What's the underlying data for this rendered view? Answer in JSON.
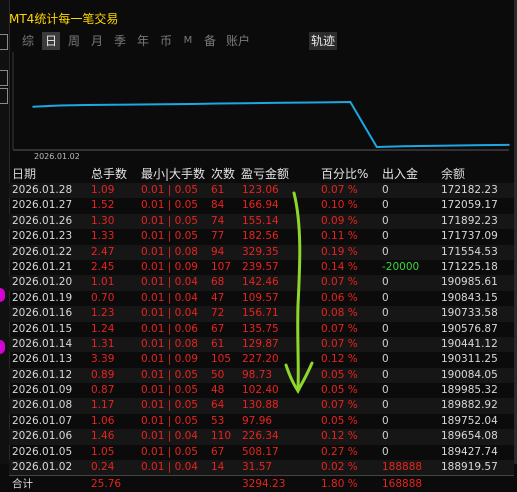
{
  "window": {
    "title": "MT4统计每一笔交易"
  },
  "tabs": [
    {
      "label": "综",
      "state": "inactive"
    },
    {
      "label": "日",
      "state": "active"
    },
    {
      "label": "周",
      "state": "inactive"
    },
    {
      "label": "月",
      "state": "inactive"
    },
    {
      "label": "季",
      "state": "inactive"
    },
    {
      "label": "年",
      "state": "inactive"
    },
    {
      "label": "币",
      "state": "inactive"
    },
    {
      "label": "M",
      "state": "inactive"
    },
    {
      "label": "备",
      "state": "inactive"
    },
    {
      "label": "账户",
      "state": "inactive"
    },
    {
      "label": "轨迹",
      "state": "selected"
    }
  ],
  "chart_data": {
    "type": "line",
    "x_start_label": "2026.01.02",
    "x": [
      "2026.01.02",
      "2026.01.05",
      "2026.01.06",
      "2026.01.07",
      "2026.01.08",
      "2026.01.09",
      "2026.01.12",
      "2026.01.13",
      "2026.01.14",
      "2026.01.15",
      "2026.01.16",
      "2026.01.19",
      "2026.01.20",
      "2026.01.21",
      "2026.01.22",
      "2026.01.23",
      "2026.01.26",
      "2026.01.27",
      "2026.01.28"
    ],
    "series": [
      {
        "values": [
          188919.57,
          189427.74,
          189654.08,
          189752.04,
          189882.92,
          189985.32,
          190084.05,
          190311.25,
          190441.12,
          190576.87,
          190733.58,
          190843.15,
          190985.61,
          171225.18,
          171554.53,
          171737.09,
          171892.23,
          172059.17,
          172182.23
        ]
      }
    ],
    "line_color": "#1ea7e1"
  },
  "table": {
    "headers": {
      "date": "日期",
      "lots": "总手数",
      "minmax": "最小|大手数",
      "count": "次数",
      "pnl": "盈亏金额",
      "pct": "百分比%",
      "io": "出入金",
      "balance": "余额"
    },
    "rows": [
      {
        "date": "2026.01.28",
        "lots": "1.09",
        "minmax": "0.01 | 0.05",
        "count": "61",
        "pnl": "123.06",
        "pct": "0.07 %",
        "io": "0",
        "balance": "172182.23"
      },
      {
        "date": "2026.01.27",
        "lots": "1.52",
        "minmax": "0.01 | 0.05",
        "count": "84",
        "pnl": "166.94",
        "pct": "0.10 %",
        "io": "0",
        "balance": "172059.17"
      },
      {
        "date": "2026.01.26",
        "lots": "1.30",
        "minmax": "0.01 | 0.05",
        "count": "74",
        "pnl": "155.14",
        "pct": "0.09 %",
        "io": "0",
        "balance": "171892.23"
      },
      {
        "date": "2026.01.23",
        "lots": "1.33",
        "minmax": "0.01 | 0.05",
        "count": "77",
        "pnl": "182.56",
        "pct": "0.11 %",
        "io": "0",
        "balance": "171737.09"
      },
      {
        "date": "2026.01.22",
        "lots": "2.47",
        "minmax": "0.01 | 0.08",
        "count": "94",
        "pnl": "329.35",
        "pct": "0.19 %",
        "io": "0",
        "balance": "171554.53"
      },
      {
        "date": "2026.01.21",
        "lots": "2.45",
        "minmax": "0.01 | 0.09",
        "count": "107",
        "pnl": "239.57",
        "pct": "0.14 %",
        "io": "-20000",
        "balance": "171225.18",
        "io_color": "green"
      },
      {
        "date": "2026.01.20",
        "lots": "1.01",
        "minmax": "0.01 | 0.04",
        "count": "68",
        "pnl": "142.46",
        "pct": "0.07 %",
        "io": "0",
        "balance": "190985.61"
      },
      {
        "date": "2026.01.19",
        "lots": "0.70",
        "minmax": "0.01 | 0.04",
        "count": "47",
        "pnl": "109.57",
        "pct": "0.06 %",
        "io": "0",
        "balance": "190843.15"
      },
      {
        "date": "2026.01.16",
        "lots": "1.23",
        "minmax": "0.01 | 0.04",
        "count": "72",
        "pnl": "156.71",
        "pct": "0.08 %",
        "io": "0",
        "balance": "190733.58"
      },
      {
        "date": "2026.01.15",
        "lots": "1.24",
        "minmax": "0.01 | 0.06",
        "count": "67",
        "pnl": "135.75",
        "pct": "0.07 %",
        "io": "0",
        "balance": "190576.87"
      },
      {
        "date": "2026.01.14",
        "lots": "1.31",
        "minmax": "0.01 | 0.08",
        "count": "61",
        "pnl": "129.87",
        "pct": "0.07 %",
        "io": "0",
        "balance": "190441.12"
      },
      {
        "date": "2026.01.13",
        "lots": "3.39",
        "minmax": "0.01 | 0.09",
        "count": "105",
        "pnl": "227.20",
        "pct": "0.12 %",
        "io": "0",
        "balance": "190311.25"
      },
      {
        "date": "2026.01.12",
        "lots": "0.89",
        "minmax": "0.01 | 0.05",
        "count": "50",
        "pnl": "98.73",
        "pct": "0.05 %",
        "io": "0",
        "balance": "190084.05"
      },
      {
        "date": "2026.01.09",
        "lots": "0.87",
        "minmax": "0.01 | 0.05",
        "count": "48",
        "pnl": "102.40",
        "pct": "0.05 %",
        "io": "0",
        "balance": "189985.32"
      },
      {
        "date": "2026.01.08",
        "lots": "1.17",
        "minmax": "0.01 | 0.05",
        "count": "64",
        "pnl": "130.88",
        "pct": "0.07 %",
        "io": "0",
        "balance": "189882.92"
      },
      {
        "date": "2026.01.07",
        "lots": "1.06",
        "minmax": "0.01 | 0.05",
        "count": "53",
        "pnl": "97.96",
        "pct": "0.05 %",
        "io": "0",
        "balance": "189752.04"
      },
      {
        "date": "2026.01.06",
        "lots": "1.46",
        "minmax": "0.01 | 0.04",
        "count": "110",
        "pnl": "226.34",
        "pct": "0.12 %",
        "io": "0",
        "balance": "189654.08"
      },
      {
        "date": "2026.01.05",
        "lots": "1.05",
        "minmax": "0.01 | 0.05",
        "count": "67",
        "pnl": "508.17",
        "pct": "0.27 %",
        "io": "0",
        "balance": "189427.74"
      },
      {
        "date": "2026.01.02",
        "lots": "0.24",
        "minmax": "0.01 | 0.04",
        "count": "14",
        "pnl": "31.57",
        "pct": "0.02 %",
        "io": "188888",
        "balance": "188919.57",
        "io_color": "red"
      }
    ],
    "total": {
      "label": "合计",
      "lots": "25.76",
      "pnl": "3294.23",
      "pct": "1.80 %",
      "io": "168888"
    }
  },
  "colors": {
    "title": "#ffd700",
    "positive": "#e8231f",
    "deposit": "#e8231f",
    "withdrawal": "#39d339",
    "annotation_arrow": "#8ed62a"
  }
}
